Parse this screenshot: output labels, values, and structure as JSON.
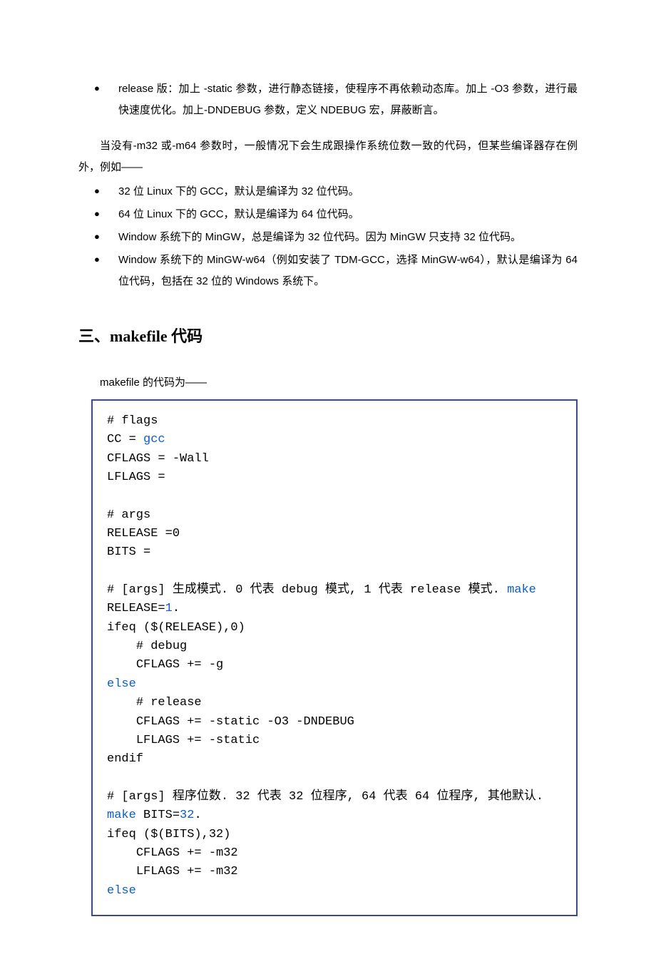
{
  "top_bullet": "release 版：加上 -static 参数，进行静态链接，使程序不再依赖动态库。加上 -O3 参数，进行最快速度优化。加上-DNDEBUG 参数，定义 NDEBUG 宏，屏蔽断言。",
  "para1": "当没有-m32 或-m64 参数时，一般情况下会生成跟操作系统位数一致的代码，但某些编译器存在例外，例如——",
  "bullets2": [
    "32 位 Linux 下的 GCC，默认是编译为 32 位代码。",
    "64 位 Linux 下的 GCC，默认是编译为 64 位代码。",
    "Window 系统下的 MinGW，总是编译为 32 位代码。因为 MinGW 只支持 32 位代码。",
    "Window 系统下的 MinGW-w64（例如安装了 TDM-GCC，选择 MinGW-w64），默认是编译为 64 位代码，包括在 32 位的 Windows 系统下。"
  ],
  "section_title": "三、makefile 代码",
  "para2": "makefile 的代码为——",
  "code": {
    "l1": "# flags",
    "l2a": "CC = ",
    "l2b": "gcc",
    "l3": "CFLAGS = -Wall",
    "l4": "LFLAGS =",
    "l5": "",
    "l6": "# args",
    "l7": "RELEASE =0",
    "l8": "BITS =",
    "l9": "",
    "l10a": "# [args] 生成模式. 0 代表 debug 模式, 1 代表 release 模式. ",
    "l10b": "make",
    "l11a": "RELEASE=",
    "l11b": "1",
    "l11c": ".",
    "l12": "ifeq ($(RELEASE),0)",
    "l13": "    # debug",
    "l14": "    CFLAGS += -g",
    "l15": "else",
    "l16": "    # release",
    "l17": "    CFLAGS += -static -O3 -DNDEBUG",
    "l18": "    LFLAGS += -static",
    "l19": "endif",
    "l20": "",
    "l21": "# [args] 程序位数. 32 代表 32 位程序, 64 代表 64 位程序, 其他默认.",
    "l22a": "make",
    "l22b": " BITS=",
    "l22c": "32",
    "l22d": ".",
    "l23": "ifeq ($(BITS),32)",
    "l24": "    CFLAGS += -m32",
    "l25": "    LFLAGS += -m32",
    "l26": "else"
  }
}
